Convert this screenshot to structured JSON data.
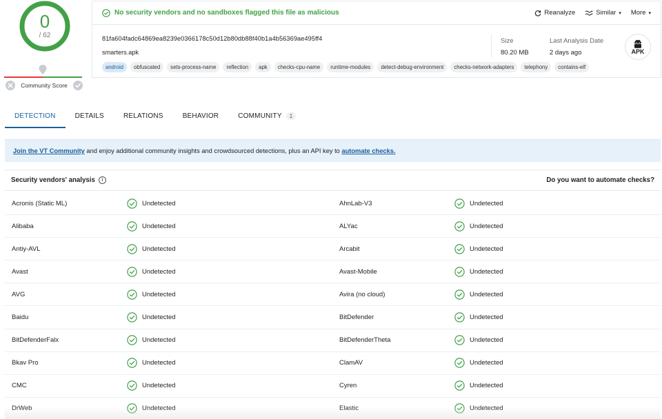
{
  "score": {
    "detections": "0",
    "total": "/ 62",
    "community_label": "Community Score"
  },
  "header": {
    "status_message": "No security vendors and no sandboxes flagged this file as malicious",
    "actions": {
      "reanalyze": "Reanalyze",
      "similar": "Similar",
      "more": "More"
    },
    "hash": "81fa604fadc64869ea8239e0366178c50d12b80db88f40b1a4b56369ae495ff4",
    "filename": "smarters.apk",
    "tags": [
      "android",
      "obfuscated",
      "sets-process-name",
      "reflection",
      "apk",
      "checks-cpu-name",
      "runtime-modules",
      "detect-debug-environment",
      "checks-network-adapters",
      "telephony",
      "contains-elf"
    ],
    "size_label": "Size",
    "size_value": "80.20 MB",
    "analysis_label": "Last Analysis Date",
    "analysis_value": "2 days ago",
    "file_type": "APK"
  },
  "tabs": [
    {
      "label": "DETECTION"
    },
    {
      "label": "DETAILS"
    },
    {
      "label": "RELATIONS"
    },
    {
      "label": "BEHAVIOR"
    },
    {
      "label": "COMMUNITY",
      "count": "1"
    }
  ],
  "banner": {
    "link1": "Join the VT Community",
    "text": " and enjoy additional community insights and crowdsourced detections, plus an API key to ",
    "link2": "automate checks."
  },
  "vendors_table": {
    "title": "Security vendors' analysis",
    "automate_prompt": "Do you want to automate checks?",
    "rows": [
      {
        "left": "Acronis (Static ML)",
        "left_status": "Undetected",
        "right": "AhnLab-V3",
        "right_status": "Undetected"
      },
      {
        "left": "Alibaba",
        "left_status": "Undetected",
        "right": "ALYac",
        "right_status": "Undetected"
      },
      {
        "left": "Antiy-AVL",
        "left_status": "Undetected",
        "right": "Arcabit",
        "right_status": "Undetected"
      },
      {
        "left": "Avast",
        "left_status": "Undetected",
        "right": "Avast-Mobile",
        "right_status": "Undetected"
      },
      {
        "left": "AVG",
        "left_status": "Undetected",
        "right": "Avira (no cloud)",
        "right_status": "Undetected"
      },
      {
        "left": "Baidu",
        "left_status": "Undetected",
        "right": "BitDefender",
        "right_status": "Undetected"
      },
      {
        "left": "BitDefenderFalx",
        "left_status": "Undetected",
        "right": "BitDefenderTheta",
        "right_status": "Undetected"
      },
      {
        "left": "Bkav Pro",
        "left_status": "Undetected",
        "right": "ClamAV",
        "right_status": "Undetected"
      },
      {
        "left": "CMC",
        "left_status": "Undetected",
        "right": "Cyren",
        "right_status": "Undetected"
      },
      {
        "left": "DrWeb",
        "left_status": "Undetected",
        "right": "Elastic",
        "right_status": "Undetected"
      }
    ]
  },
  "colors": {
    "ok_green": "#43a047",
    "accent_blue": "#1a5e99",
    "banner_bg": "#e6f1fa"
  },
  "icons": {
    "status_ok": "check-circle-icon",
    "reanalyze": "refresh-icon",
    "similar": "similar-icon",
    "file_type": "android-icon"
  }
}
